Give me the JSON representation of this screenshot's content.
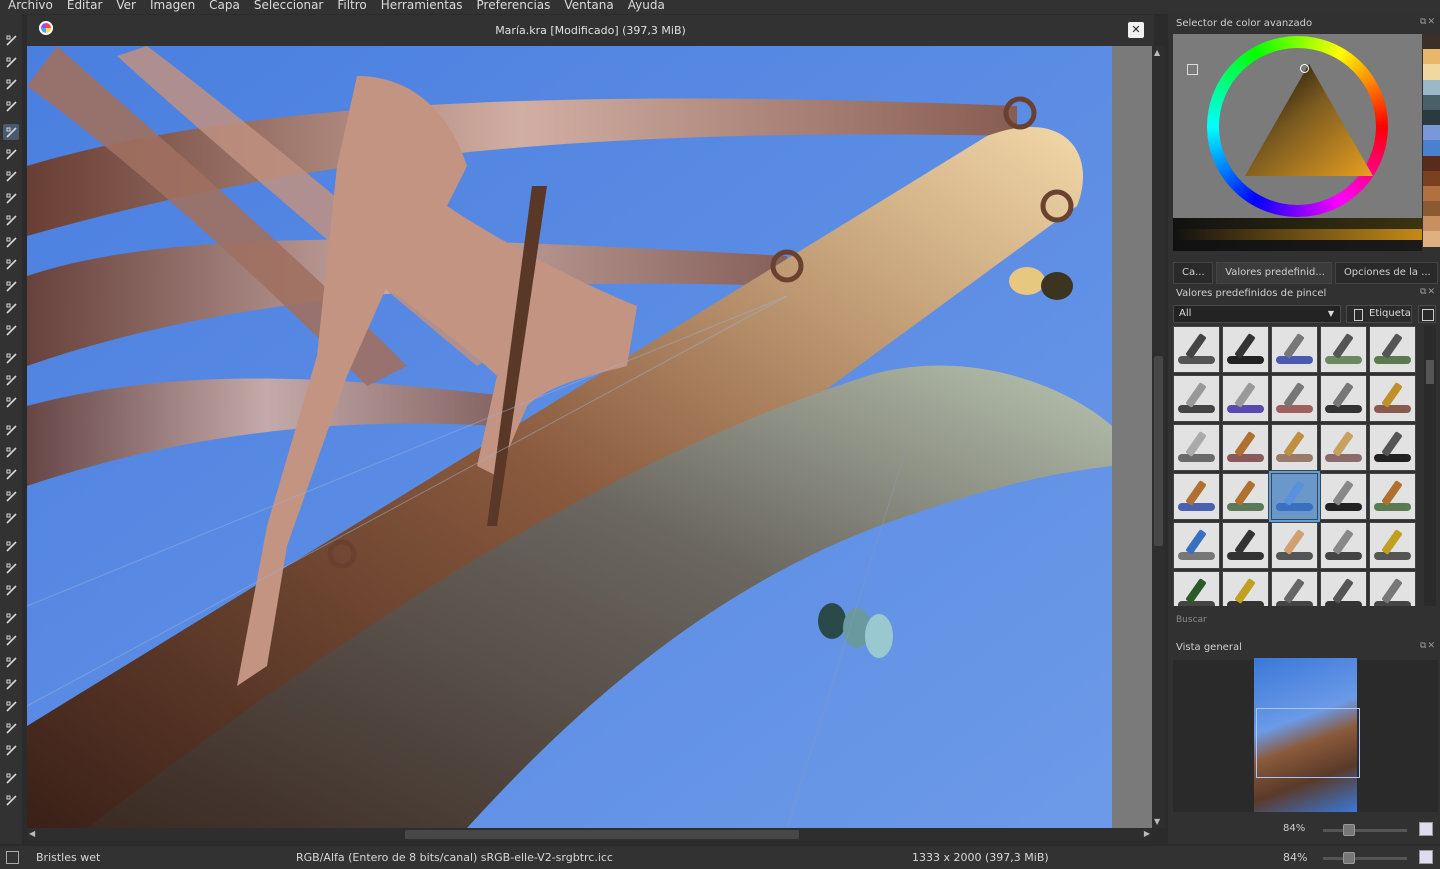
{
  "menu": [
    "Archivo",
    "Editar",
    "Ver",
    "Imagen",
    "Capa",
    "Seleccionar",
    "Filtro",
    "Herramientas",
    "Preferencias",
    "Ventana",
    "Ayuda"
  ],
  "toolbox": {
    "tools": [
      "select-shapes-icon",
      "text-icon",
      "edit-shapes-icon",
      "calligraphy-icon",
      "freehand-brush-icon",
      "line-icon",
      "rectangle-icon",
      "ellipse-icon",
      "polygon-icon",
      "polyline-icon",
      "bezier-icon",
      "freehand-path-icon",
      "dynamic-brush-icon",
      "multibrush-icon",
      "transform-icon",
      "move-icon",
      "crop-icon",
      "gradient-icon",
      "color-picker-icon",
      "smart-patch-icon",
      "fill-icon",
      "assistant-icon",
      "measure-icon",
      "reference-images-icon",
      "rect-select-icon",
      "ellipse-select-icon",
      "polygon-select-icon",
      "freehand-select-icon",
      "contiguous-select-icon",
      "similar-select-icon",
      "bezier-select-icon",
      "magnetic-select-icon",
      "zoom-icon",
      "pan-icon"
    ],
    "active": "freehand-brush-icon"
  },
  "document": {
    "title": "María.kra [Modificado]  (397,3 MiB)"
  },
  "color_selector": {
    "title": "Selector de color avanzado",
    "history_colors": [
      "#3a3028",
      "#e8b86a",
      "#f0d8a0",
      "#9ab8c8",
      "#4a6068",
      "#2a3a40",
      "#7a98d8",
      "#4a80d0",
      "#5a2a1a",
      "#7a4020",
      "#b07040",
      "#8a5a30",
      "#c89060",
      "#e0b080"
    ],
    "shade_rows": [
      "#3b3410",
      "#c48a18",
      "#1a1a1a"
    ]
  },
  "dock_tabs": [
    "Ca...",
    "Valores predefinid...",
    "Opciones de la ..."
  ],
  "brush_presets": {
    "title": "Valores predefinidos de pincel",
    "filter_value": "All",
    "tag_button": "Etiqueta",
    "search_placeholder": "Buscar",
    "presets": [
      {
        "stroke": "#555555",
        "tip": "#444444"
      },
      {
        "stroke": "#222222",
        "tip": "#333333"
      },
      {
        "stroke": "#4a5ab0",
        "tip": "#777777"
      },
      {
        "stroke": "#6a8a60",
        "tip": "#555555"
      },
      {
        "stroke": "#5a7a50",
        "tip": "#555555"
      },
      {
        "stroke": "#444444",
        "tip": "#999999"
      },
      {
        "stroke": "#5a4ab0",
        "tip": "#999999"
      },
      {
        "stroke": "#a06060",
        "tip": "#777777"
      },
      {
        "stroke": "#333333",
        "tip": "#777777"
      },
      {
        "stroke": "#8a5a50",
        "tip": "#c0902a"
      },
      {
        "stroke": "#6a6a6a",
        "tip": "#aaaaaa"
      },
      {
        "stroke": "#8a5a5a",
        "tip": "#b07030"
      },
      {
        "stroke": "#9a7a6a",
        "tip": "#c09040"
      },
      {
        "stroke": "#8a6a6a",
        "tip": "#c8a060"
      },
      {
        "stroke": "#222222",
        "tip": "#555555"
      },
      {
        "stroke": "#4a60b0",
        "tip": "#b07030"
      },
      {
        "stroke": "#5a7a5a",
        "tip": "#b07030"
      },
      {
        "stroke": "#3a70c0",
        "tip": "#5a90e0"
      },
      {
        "stroke": "#222222",
        "tip": "#888888"
      },
      {
        "stroke": "#5a7a50",
        "tip": "#b07030"
      },
      {
        "stroke": "#777777",
        "tip": "#3a70c0"
      },
      {
        "stroke": "#333333",
        "tip": "#333333"
      },
      {
        "stroke": "#555555",
        "tip": "#d0a070"
      },
      {
        "stroke": "#444444",
        "tip": "#888888"
      },
      {
        "stroke": "#555555",
        "tip": "#c0a020"
      },
      {
        "stroke": "#444444",
        "tip": "#2a5a2a"
      },
      {
        "stroke": "#333333",
        "tip": "#c0a020"
      },
      {
        "stroke": "#444444",
        "tip": "#666666"
      },
      {
        "stroke": "#333333",
        "tip": "#555555"
      },
      {
        "stroke": "#444444",
        "tip": "#777777"
      }
    ],
    "selected_index": 17
  },
  "overview": {
    "title": "Vista general",
    "zoom_label": "84%"
  },
  "status": {
    "brush_name": "Bristles wet",
    "color_space": "RGB/Alfa (Entero de 8 bits/canal)  sRGB-elle-V2-srgbtrc.icc",
    "image_size": "1333 x 2000 (397,3 MiB)",
    "zoom": "84%"
  }
}
